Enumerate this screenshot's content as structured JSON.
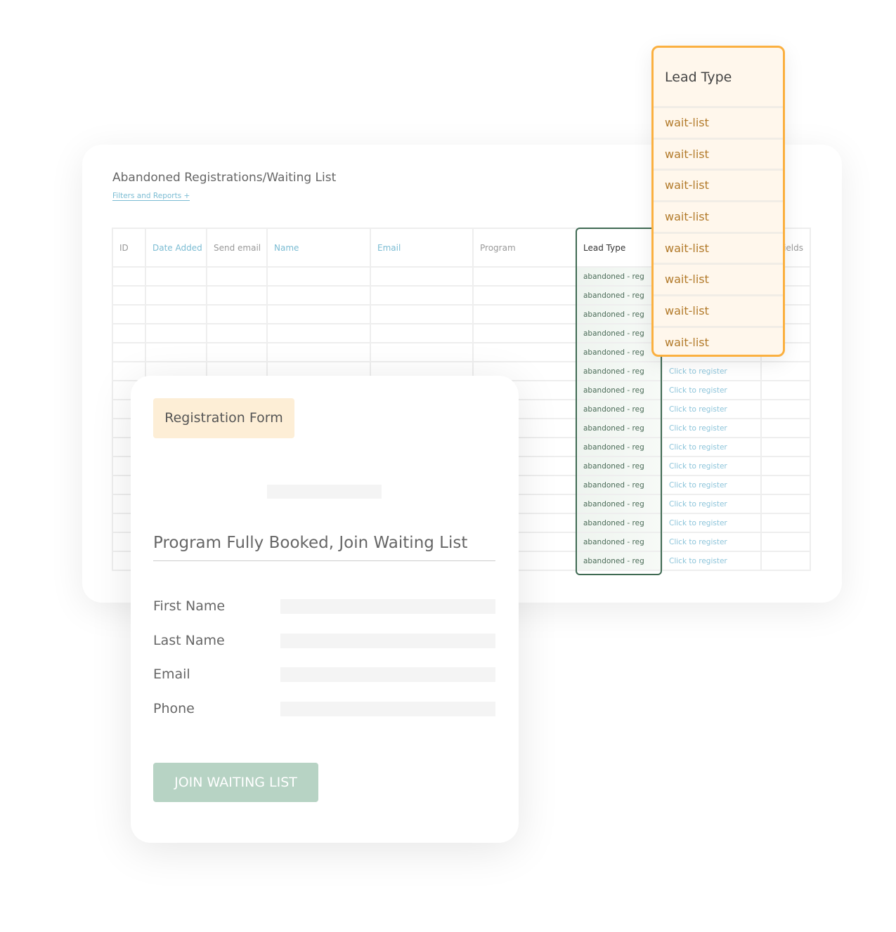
{
  "table_card": {
    "title": "Abandoned Registrations/Waiting List",
    "filters_link": "Filters and Reports +",
    "columns": [
      {
        "label": "ID",
        "link": false
      },
      {
        "label": "Date Added",
        "link": true
      },
      {
        "label": "Send email",
        "link": false
      },
      {
        "label": "Name",
        "link": true
      },
      {
        "label": "Email",
        "link": true
      },
      {
        "label": "Program",
        "link": false
      },
      {
        "label": "Lead Type",
        "link": false
      },
      {
        "label": "",
        "link": false
      },
      {
        "label": "ields",
        "link": false
      }
    ],
    "lead_type_value": "abandoned - reg",
    "register_link": "Click to register",
    "row_count": 16
  },
  "lead_popup": {
    "title": "Lead Type",
    "items": [
      "wait-list",
      "wait-list",
      "wait-list",
      "wait-list",
      "wait-list",
      "wait-list",
      "wait-list",
      "wait-list"
    ],
    "accent": "#fbb040"
  },
  "form": {
    "badge": "Registration Form",
    "heading": "Program Fully Booked, Join Waiting List",
    "fields": [
      "First Name",
      "Last Name",
      "Email",
      "Phone"
    ],
    "submit": "JOIN WAITING LIST"
  }
}
